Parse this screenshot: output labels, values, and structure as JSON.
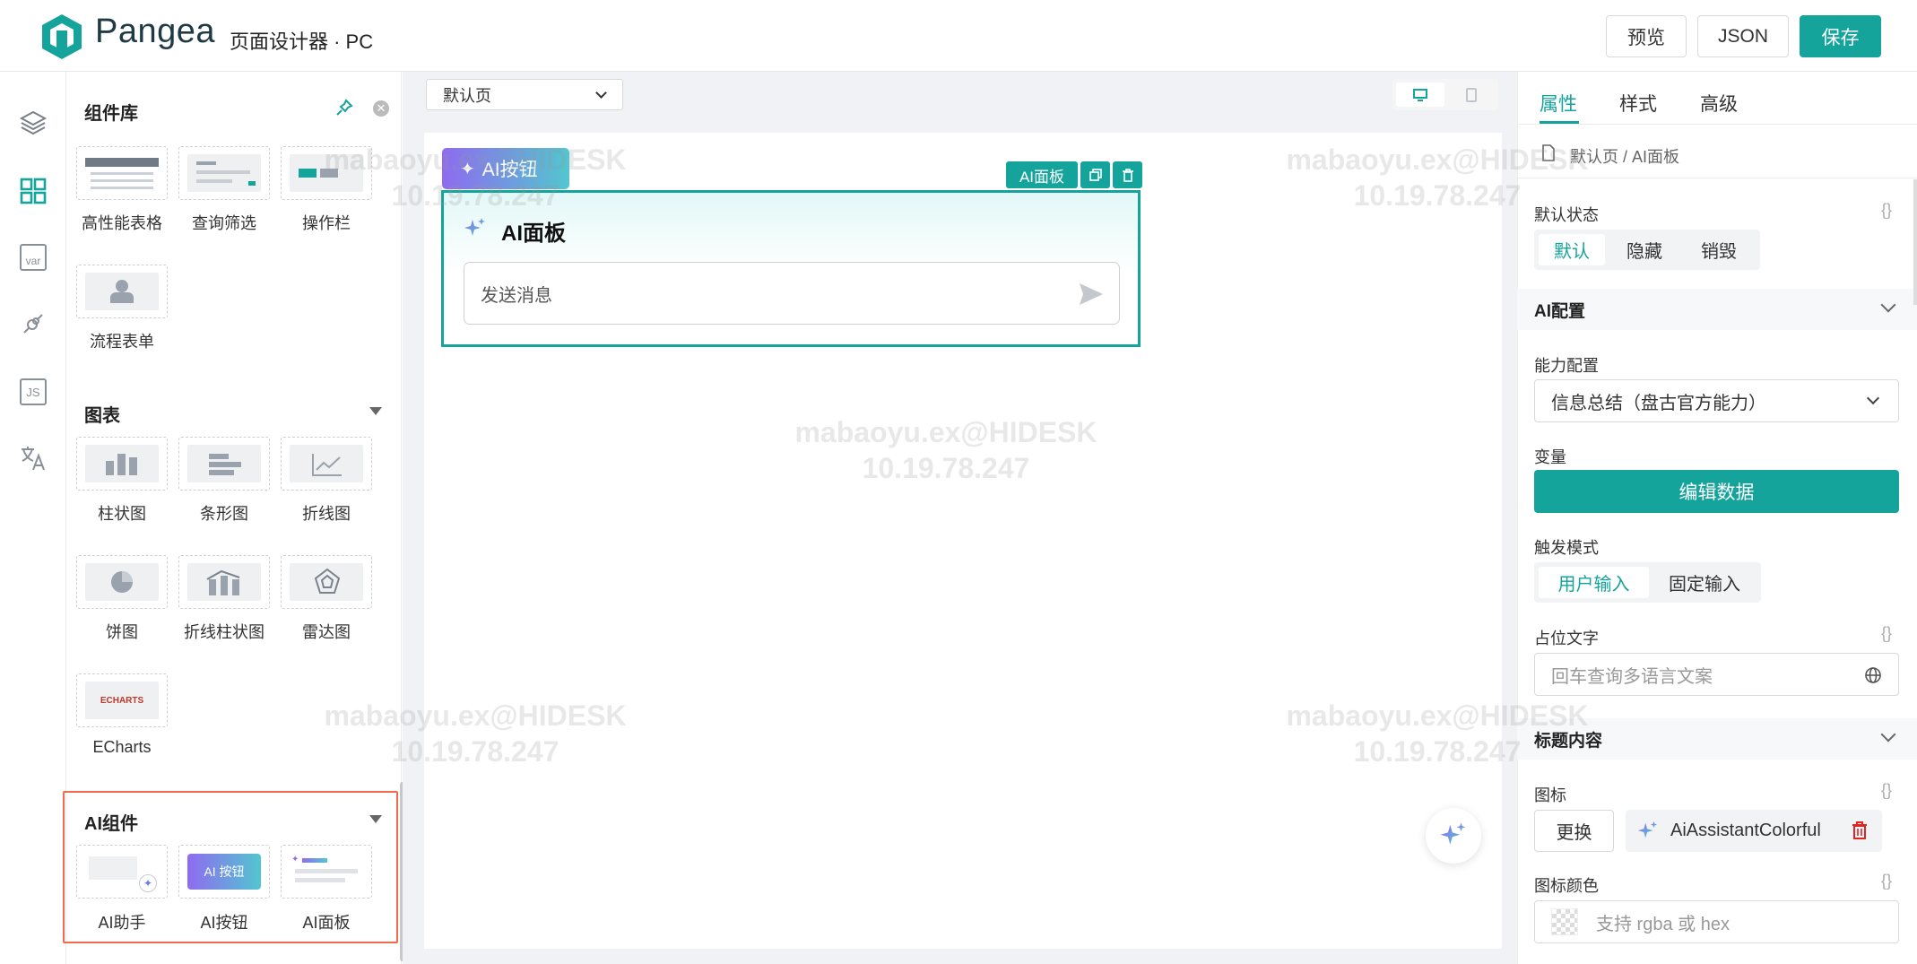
{
  "header": {
    "logo_text": "Pangea",
    "subtitle": "页面设计器 · PC",
    "preview_label": "预览",
    "json_label": "JSON",
    "save_label": "保存"
  },
  "rail": {
    "icons": [
      "layers-icon",
      "components-grid-icon",
      "variable-icon",
      "plug-icon",
      "js-icon",
      "translate-icon"
    ],
    "var_text": "var",
    "js_text": "JS"
  },
  "component_panel": {
    "title": "组件库",
    "basic_items": [
      {
        "label": "高性能表格"
      },
      {
        "label": "查询筛选"
      },
      {
        "label": "操作栏"
      },
      {
        "label": "流程表单"
      }
    ],
    "charts_title": "图表",
    "chart_items": [
      {
        "label": "柱状图"
      },
      {
        "label": "条形图"
      },
      {
        "label": "折线图"
      },
      {
        "label": "饼图"
      },
      {
        "label": "折线柱状图"
      },
      {
        "label": "雷达图"
      },
      {
        "label": "ECharts"
      }
    ],
    "echarts_logo_text": "ECHARTS",
    "ai_title": "AI组件",
    "ai_items": [
      {
        "label": "AI助手"
      },
      {
        "label": "AI按钮"
      },
      {
        "label": "AI面板"
      }
    ],
    "ai_button_tile_text": "AI 按钮"
  },
  "canvas": {
    "page_select_value": "默认页",
    "ai_button_label": "AI按钮",
    "selection_label": "AI面板",
    "ai_panel_title": "AI面板",
    "ai_panel_placeholder": "发送消息"
  },
  "watermark": {
    "line1": "mabaoyu.ex@HIDESK",
    "line2": "10.19.78.247"
  },
  "properties": {
    "tabs": [
      "属性",
      "样式",
      "高级"
    ],
    "breadcrumb": "默认页 / AI面板",
    "default_state_label": "默认状态",
    "default_state_options": [
      "默认",
      "隐藏",
      "销毁"
    ],
    "default_state_selected": "默认",
    "ai_config_section": "AI配置",
    "capability_label": "能力配置",
    "capability_value": "信息总结（盘古官方能力）",
    "variable_label": "变量",
    "edit_data_label": "编辑数据",
    "trigger_label": "触发模式",
    "trigger_options": [
      "用户输入",
      "固定输入"
    ],
    "trigger_selected": "用户输入",
    "placeholder_label": "占位文字",
    "placeholder_input_placeholder": "回车查询多语言文案",
    "title_section": "标题内容",
    "icon_label": "图标",
    "replace_label": "更换",
    "icon_name": "AiAssistantColorful",
    "icon_color_label": "图标颜色",
    "icon_color_placeholder": "支持 rgba 或 hex",
    "brace_text": "{}"
  },
  "colors": {
    "accent": "#14a49b",
    "highlight": "#ef6a4f",
    "ai_gradient_start": "#8f6bf0",
    "ai_gradient_end": "#52c6cf"
  }
}
